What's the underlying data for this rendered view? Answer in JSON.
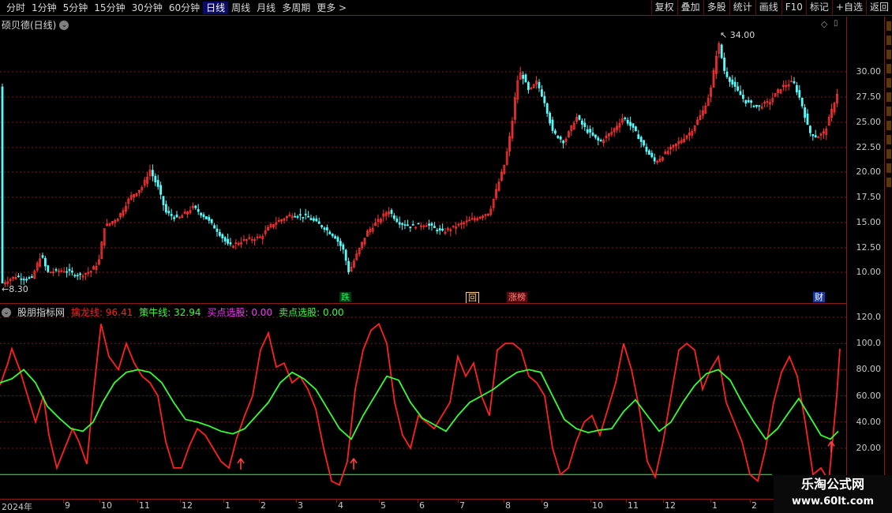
{
  "toolbar": {
    "periods": [
      "分时",
      "1分钟",
      "5分钟",
      "15分钟",
      "30分钟",
      "60分钟",
      "日线",
      "周线",
      "月线",
      "多周期",
      "更多 >"
    ],
    "active_period": "日线",
    "actions": [
      "复权",
      "叠加",
      "多股",
      "统计",
      "画线",
      "F10",
      "标记",
      "+自选",
      "返回"
    ]
  },
  "main": {
    "title": "硕贝德(日线)",
    "high_label": "34.00",
    "low_label": "8.30",
    "price_axis": [
      "30.00",
      "27.50",
      "25.00",
      "22.50",
      "20.00",
      "17.50",
      "15.00",
      "12.50",
      "10.00"
    ],
    "tags": [
      {
        "text": "跌",
        "color": "#00ff66"
      },
      {
        "text": "回",
        "color": "#ffd080"
      },
      {
        "text": "涨榜",
        "color": "#ff8080"
      },
      {
        "text": "财",
        "color": "#ffffff"
      }
    ]
  },
  "indicator": {
    "name": "股朋指标网",
    "legend": [
      {
        "label": "擒龙线",
        "value": "96.41",
        "color": "#ff2020"
      },
      {
        "label": "策牛线",
        "value": "32.94",
        "color": "#33ff33"
      },
      {
        "label": "买点选股",
        "value": "0.00",
        "color": "#ff33ff"
      },
      {
        "label": "卖点选股",
        "value": "0.00",
        "color": "#33ff33"
      }
    ],
    "axis": [
      "120.0",
      "100.0",
      "80.00",
      "60.00",
      "40.00",
      "20.00"
    ]
  },
  "date_axis": [
    "2024年",
    "9",
    "10",
    "11",
    "12",
    "1",
    "2",
    "3",
    "4",
    "5",
    "6",
    "7",
    "8",
    "9",
    "10",
    "11",
    "12",
    "1",
    "2"
  ],
  "watermark": {
    "line1": "乐淘公式网",
    "line2": "www.60lt.com"
  },
  "colors": {
    "up": "#ff3232",
    "down": "#54fcfc",
    "grid": "#8a1a1a",
    "ma_red": "#ff2020",
    "ma_green": "#33ff33"
  }
}
